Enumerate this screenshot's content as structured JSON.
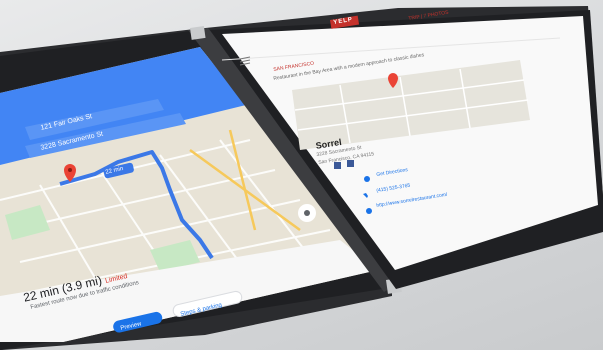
{
  "maps": {
    "from": "121 Fair Oaks St",
    "to": "3228 Sacramento St",
    "route_time_chip": "22 min",
    "summary_time": "22 min",
    "summary_distance": "(3.9 mi)",
    "summary_status": "Limited",
    "summary_note": "Fastest route now due to traffic conditions",
    "preview_label": "Preview",
    "steps_label": "Steps & parking"
  },
  "listing": {
    "logo": "YELP",
    "top_link": "TRIP | 7 PHOTOS",
    "city_tag": "SAN FRANCISCO",
    "snippet": "Restaurant in the Bay Area with a modern approach to classic dishes",
    "name": "Sorrel",
    "address": "3228 Sacramento St",
    "city": "San Francisco, CA 94115",
    "directions_label": "Get Directions",
    "phone": "(415) 525-3765",
    "website": "http://www.sorrelrestaurant.com/"
  },
  "colors": {
    "maps_blue": "#4285f4",
    "route_blue": "#3b78e7",
    "pin_red": "#ea4335",
    "brand_red": "#c4312b"
  }
}
